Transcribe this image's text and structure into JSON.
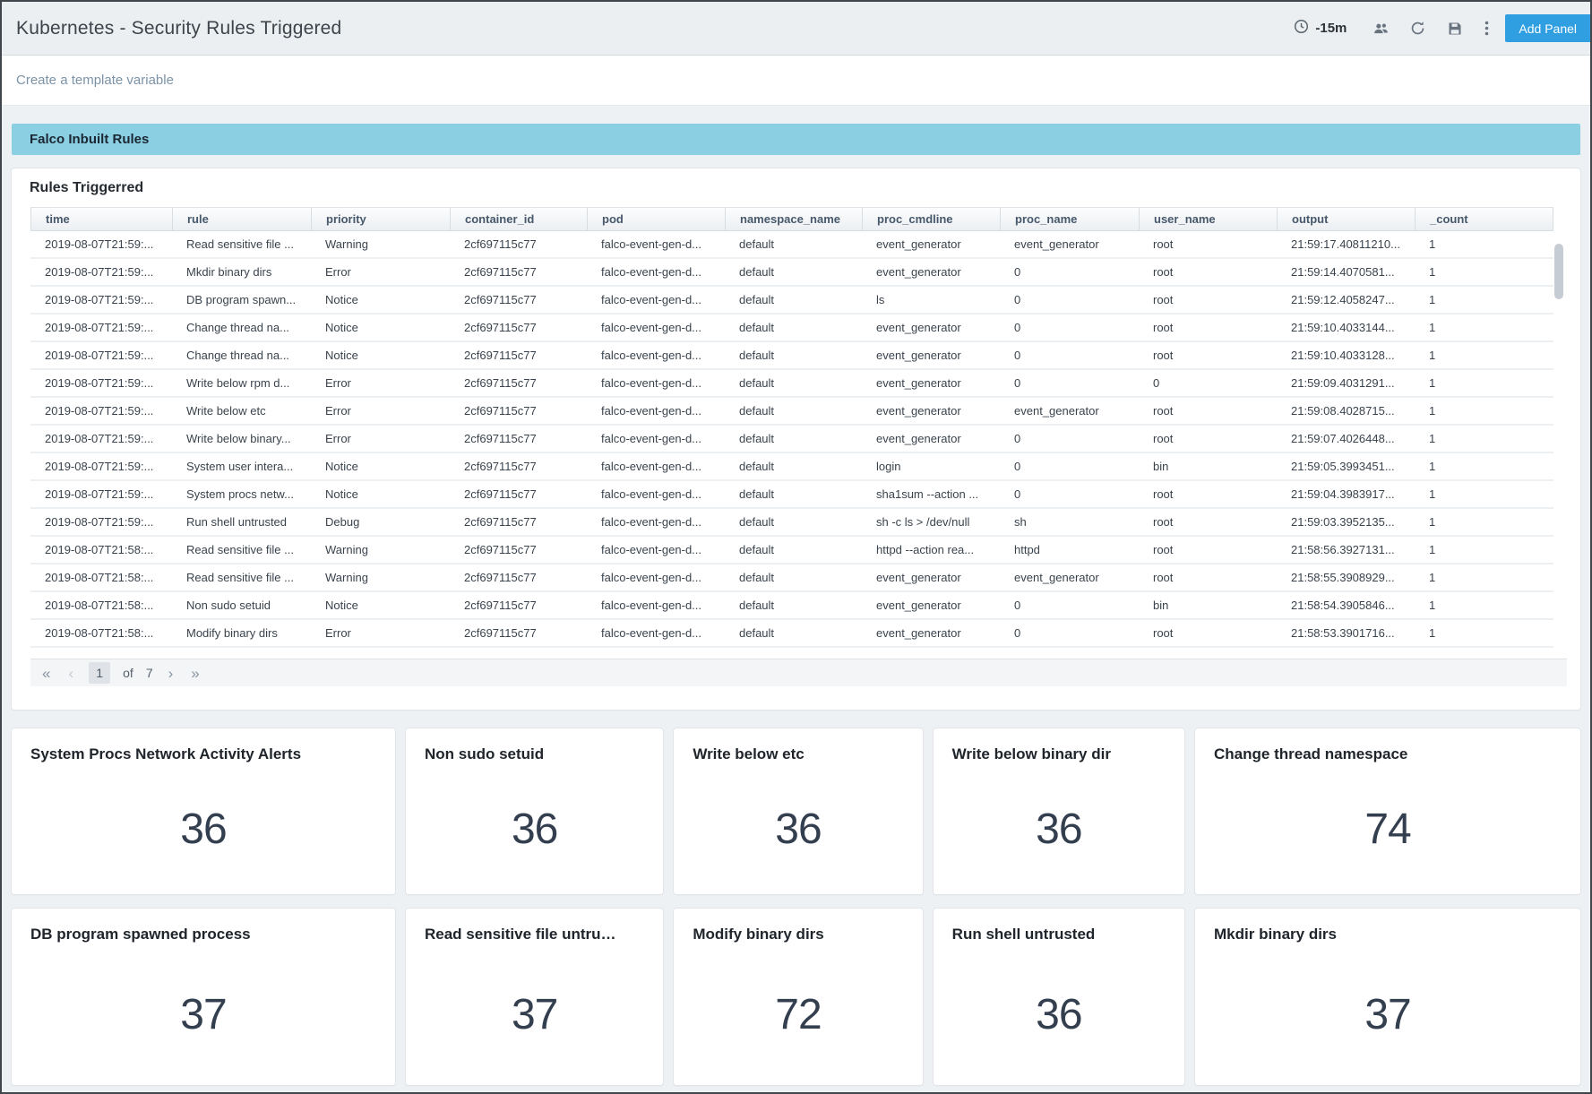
{
  "header": {
    "title": "Kubernetes - Security Rules Triggered",
    "time_range": "-15m",
    "add_panel_label": "Add Panel"
  },
  "subheader": {
    "template_variable_link": "Create a template variable"
  },
  "row_header": {
    "label": "Falco Inbuilt Rules"
  },
  "table_panel": {
    "title": "Rules Triggerred",
    "columns": [
      "time",
      "rule",
      "priority",
      "container_id",
      "pod",
      "namespace_name",
      "proc_cmdline",
      "proc_name",
      "user_name",
      "output",
      "_count"
    ],
    "rows": [
      [
        "2019-08-07T21:59:...",
        "Read sensitive file ...",
        "Warning",
        "2cf697115c77",
        "falco-event-gen-d...",
        "default",
        "event_generator",
        "event_generator",
        "root",
        "21:59:17.40811210...",
        "1"
      ],
      [
        "2019-08-07T21:59:...",
        "Mkdir binary dirs",
        "Error",
        "2cf697115c77",
        "falco-event-gen-d...",
        "default",
        "event_generator",
        "0",
        "root",
        "21:59:14.4070581...",
        "1"
      ],
      [
        "2019-08-07T21:59:...",
        "DB program spawn...",
        "Notice",
        "2cf697115c77",
        "falco-event-gen-d...",
        "default",
        "ls",
        "0",
        "root",
        "21:59:12.4058247...",
        "1"
      ],
      [
        "2019-08-07T21:59:...",
        "Change thread na...",
        "Notice",
        "2cf697115c77",
        "falco-event-gen-d...",
        "default",
        "event_generator",
        "0",
        "root",
        "21:59:10.4033144...",
        "1"
      ],
      [
        "2019-08-07T21:59:...",
        "Change thread na...",
        "Notice",
        "2cf697115c77",
        "falco-event-gen-d...",
        "default",
        "event_generator",
        "0",
        "root",
        "21:59:10.4033128...",
        "1"
      ],
      [
        "2019-08-07T21:59:...",
        "Write below rpm d...",
        "Error",
        "2cf697115c77",
        "falco-event-gen-d...",
        "default",
        "event_generator",
        "0",
        "0",
        "21:59:09.4031291...",
        "1"
      ],
      [
        "2019-08-07T21:59:...",
        "Write below etc",
        "Error",
        "2cf697115c77",
        "falco-event-gen-d...",
        "default",
        "event_generator",
        "event_generator",
        "root",
        "21:59:08.4028715...",
        "1"
      ],
      [
        "2019-08-07T21:59:...",
        "Write below binary...",
        "Error",
        "2cf697115c77",
        "falco-event-gen-d...",
        "default",
        "event_generator",
        "0",
        "root",
        "21:59:07.4026448...",
        "1"
      ],
      [
        "2019-08-07T21:59:...",
        "System user intera...",
        "Notice",
        "2cf697115c77",
        "falco-event-gen-d...",
        "default",
        "login",
        "0",
        "bin",
        "21:59:05.3993451...",
        "1"
      ],
      [
        "2019-08-07T21:59:...",
        "System procs netw...",
        "Notice",
        "2cf697115c77",
        "falco-event-gen-d...",
        "default",
        "sha1sum --action ...",
        "0",
        "root",
        "21:59:04.3983917...",
        "1"
      ],
      [
        "2019-08-07T21:59:...",
        "Run shell untrusted",
        "Debug",
        "2cf697115c77",
        "falco-event-gen-d...",
        "default",
        "sh -c ls > /dev/null",
        "sh",
        "root",
        "21:59:03.3952135...",
        "1"
      ],
      [
        "2019-08-07T21:58:...",
        "Read sensitive file ...",
        "Warning",
        "2cf697115c77",
        "falco-event-gen-d...",
        "default",
        "httpd --action rea...",
        "httpd",
        "root",
        "21:58:56.3927131...",
        "1"
      ],
      [
        "2019-08-07T21:58:...",
        "Read sensitive file ...",
        "Warning",
        "2cf697115c77",
        "falco-event-gen-d...",
        "default",
        "event_generator",
        "event_generator",
        "root",
        "21:58:55.3908929...",
        "1"
      ],
      [
        "2019-08-07T21:58:...",
        "Non sudo setuid",
        "Notice",
        "2cf697115c77",
        "falco-event-gen-d...",
        "default",
        "event_generator",
        "0",
        "bin",
        "21:58:54.3905846...",
        "1"
      ],
      [
        "2019-08-07T21:58:...",
        "Modify binary dirs",
        "Error",
        "2cf697115c77",
        "falco-event-gen-d...",
        "default",
        "event_generator",
        "0",
        "root",
        "21:58:53.3901716...",
        "1"
      ]
    ],
    "pagination": {
      "first_icon": "«",
      "prev_icon": "‹",
      "current": "1",
      "of_label": "of",
      "total": "7",
      "next_icon": "›",
      "last_icon": "»"
    }
  },
  "stat_panels": [
    {
      "title": "System Procs Network Activity Alerts",
      "value": "36"
    },
    {
      "title": "Non sudo setuid",
      "value": "36"
    },
    {
      "title": "Write below etc",
      "value": "36"
    },
    {
      "title": "Write below binary dir",
      "value": "36"
    },
    {
      "title": "Change thread namespace",
      "value": "74"
    },
    {
      "title": "DB program spawned process",
      "value": "37"
    },
    {
      "title": "Read sensitive file untru…",
      "value": "37"
    },
    {
      "title": "Modify binary dirs",
      "value": "72"
    },
    {
      "title": "Run shell untrusted",
      "value": "36"
    },
    {
      "title": "Mkdir binary dirs",
      "value": "37"
    }
  ],
  "colors": {
    "row_banner_bg": "#8bcfe3",
    "add_panel_button_bg": "#2f9fe2",
    "page_bg": "#eef1f4",
    "topbar_bg": "#ebeff2",
    "stat_value_color": "#333e4e"
  }
}
